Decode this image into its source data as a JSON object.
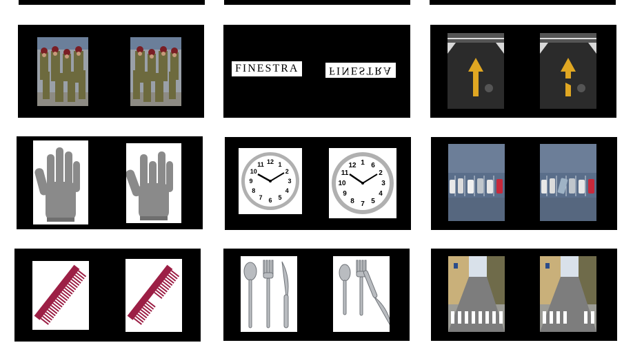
{
  "panels": {
    "word_pair": {
      "left_word": "FINESTRA",
      "right_word": "FINESTRA"
    },
    "clock_numbers_left": [
      "12",
      "1",
      "2",
      "3",
      "4",
      "5",
      "6",
      "7",
      "8",
      "9",
      "10",
      "11"
    ],
    "clock_numbers_right": [
      "1",
      "6",
      "2",
      "3",
      "4",
      "5",
      "7",
      "8",
      "9",
      "10",
      "11",
      "12"
    ]
  },
  "colors": {
    "panel_bg": "#000000",
    "comb": "#9c1f45",
    "arrow": "#e0a722",
    "road": "#2b2b2b",
    "parking": "#5a6e8a",
    "glove": "#8a8a8a",
    "uniform": "#6d6a3e"
  }
}
